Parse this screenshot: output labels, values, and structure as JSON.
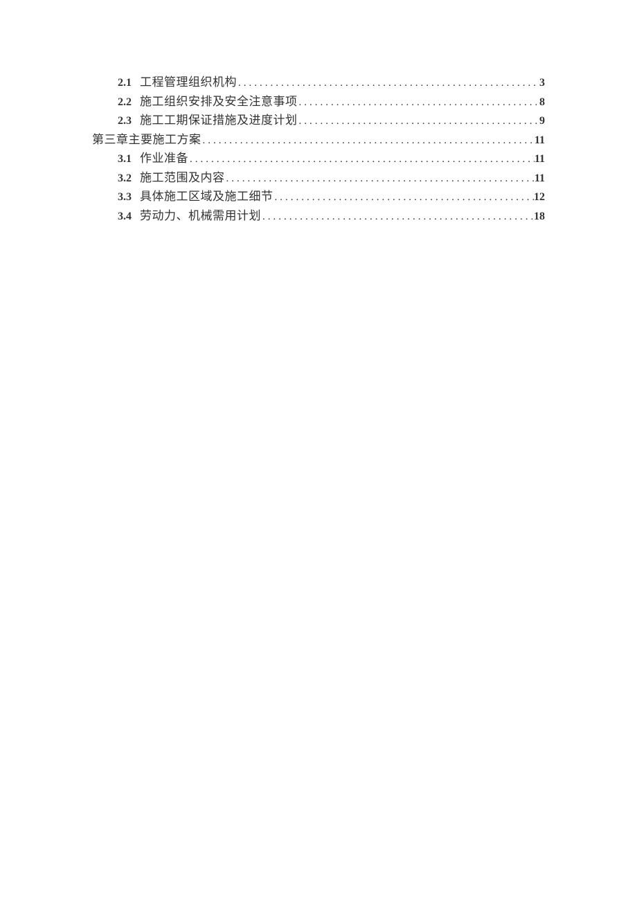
{
  "toc": [
    {
      "number": "2.1",
      "title": "工程管理组织机构",
      "page": "3",
      "indent": true
    },
    {
      "number": "2.2",
      "title": "施工组织安排及安全注意事项",
      "page": "8",
      "indent": true
    },
    {
      "number": "2.3",
      "title": "施工工期保证措施及进度计划",
      "page": "9",
      "indent": true
    },
    {
      "number": "",
      "title": "第三章主要施工方案 ",
      "page": "11",
      "indent": false
    },
    {
      "number": "3.1",
      "title": "作业准备",
      "page": "11",
      "indent": true
    },
    {
      "number": "3.2",
      "title": "施工范围及内容",
      "page": "11",
      "indent": true
    },
    {
      "number": "3.3",
      "title": "具体施工区域及施工细节",
      "page": "12",
      "indent": true
    },
    {
      "number": "3.4",
      "title": "劳动力、机械需用计划",
      "page": "18",
      "indent": true
    }
  ]
}
